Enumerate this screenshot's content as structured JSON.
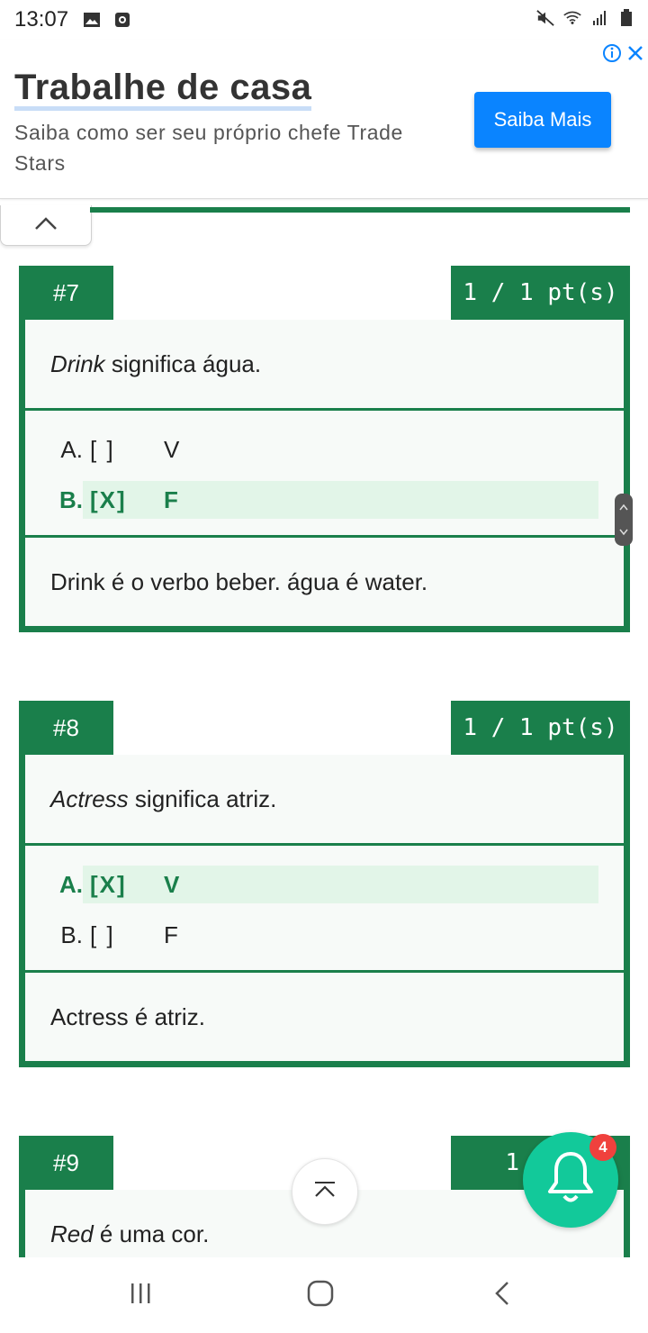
{
  "status_bar": {
    "time": "13:07",
    "icons_left": [
      "image-icon",
      "notification-box-icon"
    ],
    "icons_right": [
      "mute-icon",
      "wifi-icon",
      "signal-icon",
      "battery-icon"
    ]
  },
  "ad": {
    "title": "Trabalhe de casa",
    "subtitle": "Saiba como ser seu próprio chefe Trade Stars",
    "cta_label": "Saiba Mais",
    "accent_color": "#0a84ff"
  },
  "theme": {
    "green": "#1a7f4b",
    "highlight": "#e2f5e8"
  },
  "questions": [
    {
      "number": "#7",
      "points": "1 / 1 pt(s)",
      "term": "Drink",
      "question_rest": " significa água.",
      "options": [
        {
          "letter": "A.",
          "box": "[ ]",
          "value": "V"
        },
        {
          "letter": "B.",
          "box": "[X]",
          "value": "F"
        }
      ],
      "explanation": "Drink é o verbo beber. água é water."
    },
    {
      "number": "#8",
      "points": "1 / 1 pt(s)",
      "term": "Actress",
      "question_rest": " significa atriz.",
      "options": [
        {
          "letter": "A.",
          "box": "[X]",
          "value": "V"
        },
        {
          "letter": "B.",
          "box": "[ ]",
          "value": "F"
        }
      ],
      "explanation": "Actress é atriz."
    },
    {
      "number": "#9",
      "points": "1 / 1",
      "term": "Red",
      "question_rest": " é uma cor."
    }
  ],
  "notifications": {
    "badge_count": "4"
  }
}
